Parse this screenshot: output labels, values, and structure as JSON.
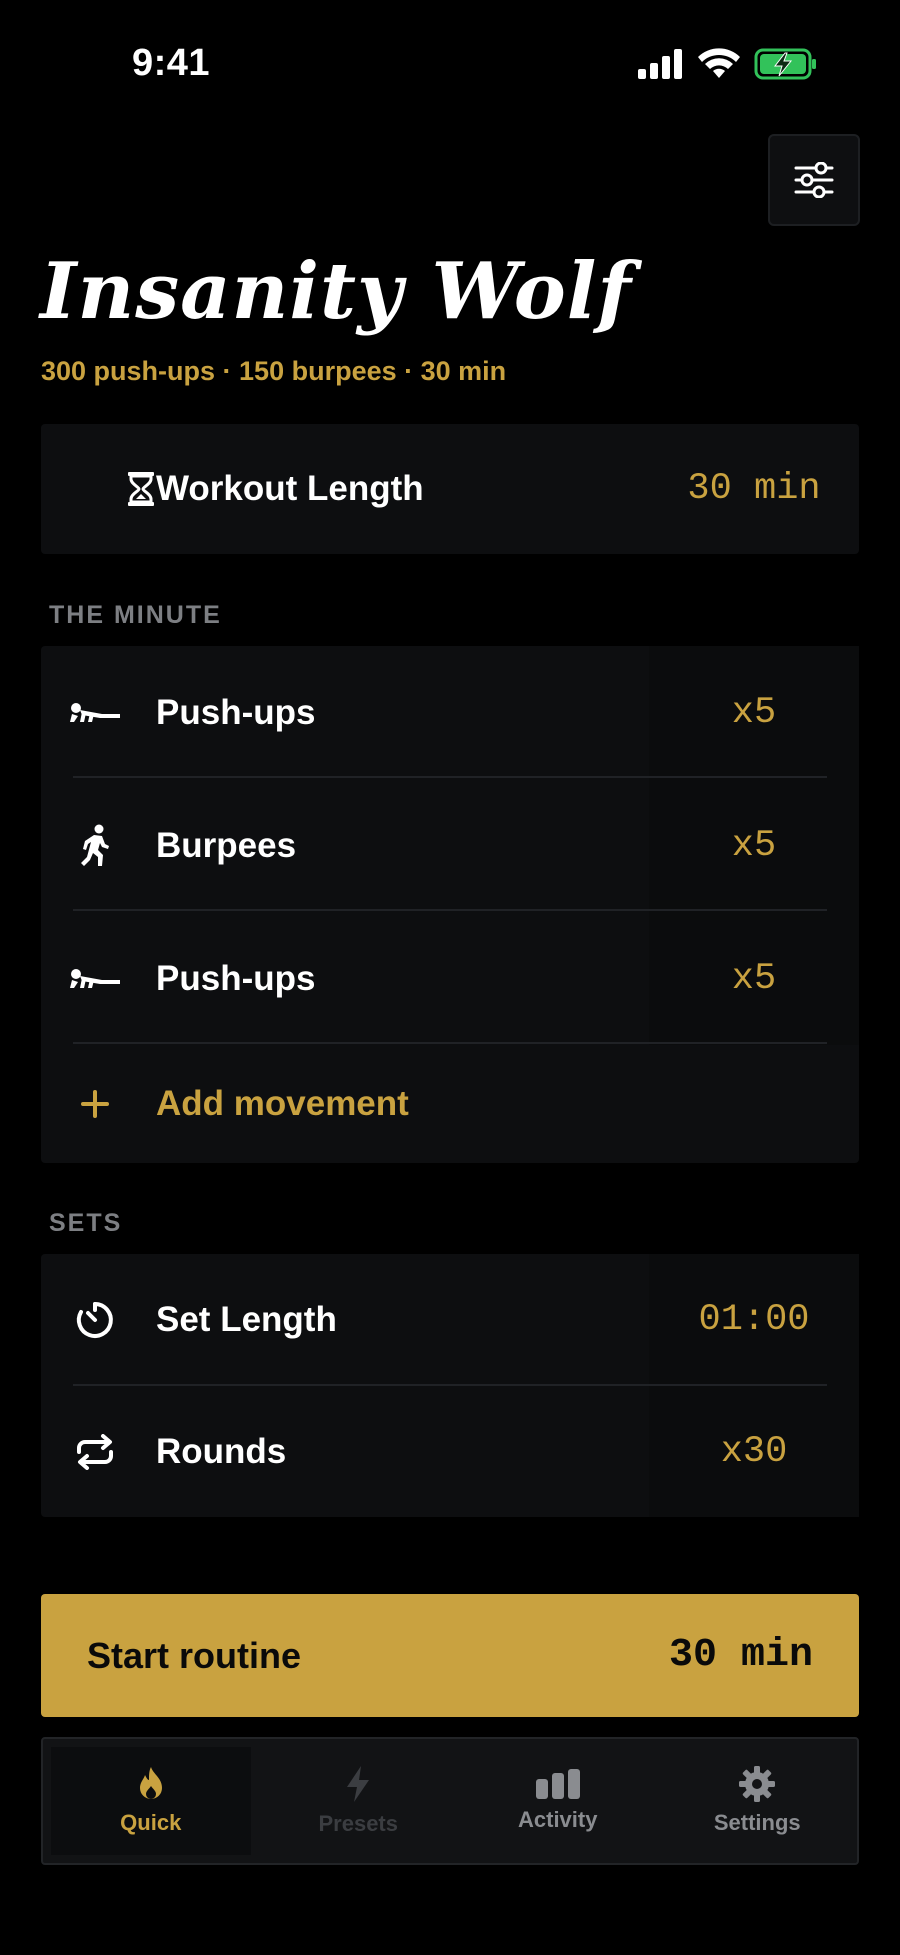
{
  "status_bar": {
    "time": "9:41"
  },
  "header": {
    "title": "Insanity Wolf",
    "subtitle": "300 push-ups · 150 burpees · 30 min"
  },
  "workout_length": {
    "label": "Workout Length",
    "value": "30 min"
  },
  "the_minute": {
    "section_label": "THE MINUTE",
    "items": [
      {
        "label": "Push-ups",
        "value": "x5",
        "icon": "push-up-icon"
      },
      {
        "label": "Burpees",
        "value": "x5",
        "icon": "running-person-icon"
      },
      {
        "label": "Push-ups",
        "value": "x5",
        "icon": "push-up-icon"
      }
    ],
    "add_label": "Add movement"
  },
  "sets": {
    "section_label": "SETS",
    "set_length": {
      "label": "Set Length",
      "value": "01:00"
    },
    "rounds": {
      "label": "Rounds",
      "value": "x30"
    }
  },
  "start": {
    "label": "Start routine",
    "value": "30 min"
  },
  "tabs": [
    {
      "label": "Quick",
      "icon": "flame-icon",
      "state": "active"
    },
    {
      "label": "Presets",
      "icon": "bolt-icon",
      "state": "disabled"
    },
    {
      "label": "Activity",
      "icon": "bar-chart-icon",
      "state": "inactive"
    },
    {
      "label": "Settings",
      "icon": "gear-icon",
      "state": "inactive"
    }
  ],
  "colors": {
    "accent": "#c9a240",
    "background": "#000000",
    "card": "#0d0e10",
    "battery": "#32c25a"
  }
}
